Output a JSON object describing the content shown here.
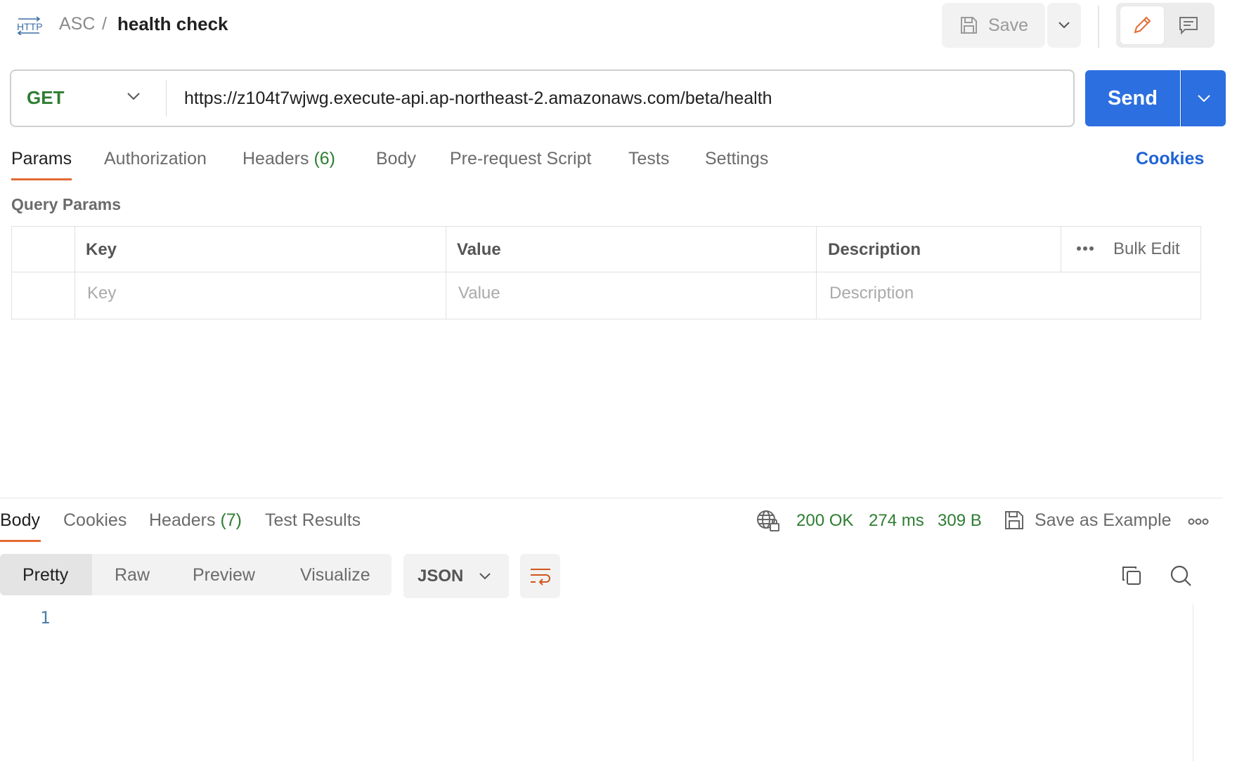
{
  "header": {
    "breadcrumb": {
      "workspace": "ASC",
      "separator": "/",
      "request_name": "health check"
    },
    "save_label": "Save",
    "icons": {
      "request_type": "http-icon",
      "save": "save-icon",
      "edit": "pencil-icon",
      "comments": "comment-icon"
    }
  },
  "request": {
    "method": "GET",
    "url": "https://z104t7wjwg.execute-api.ap-northeast-2.amazonaws.com/beta/health",
    "send_label": "Send",
    "tabs": [
      {
        "label": "Params"
      },
      {
        "label": "Authorization"
      },
      {
        "label": "Headers",
        "count": "(6)"
      },
      {
        "label": "Body"
      },
      {
        "label": "Pre-request Script"
      },
      {
        "label": "Tests"
      },
      {
        "label": "Settings"
      }
    ],
    "active_tab": "Params",
    "cookies_label": "Cookies"
  },
  "params": {
    "title": "Query Params",
    "columns": {
      "key": "Key",
      "value": "Value",
      "description": "Description"
    },
    "bulk_edit": "Bulk Edit",
    "placeholders": {
      "key": "Key",
      "value": "Value",
      "description": "Description"
    }
  },
  "response": {
    "tabs": [
      {
        "label": "Body"
      },
      {
        "label": "Cookies"
      },
      {
        "label": "Headers",
        "count": "(7)"
      },
      {
        "label": "Test Results"
      }
    ],
    "active_tab": "Body",
    "status": "200 OK",
    "time": "274 ms",
    "size": "309 B",
    "save_example": "Save as Example",
    "view_modes": [
      "Pretty",
      "Raw",
      "Preview",
      "Visualize"
    ],
    "active_view": "Pretty",
    "format": "JSON",
    "line_numbers": [
      "1"
    ]
  },
  "colors": {
    "accent": "#e36a33",
    "send": "#2c6fe0",
    "success": "#2e7d32",
    "link": "#1f63d6"
  }
}
